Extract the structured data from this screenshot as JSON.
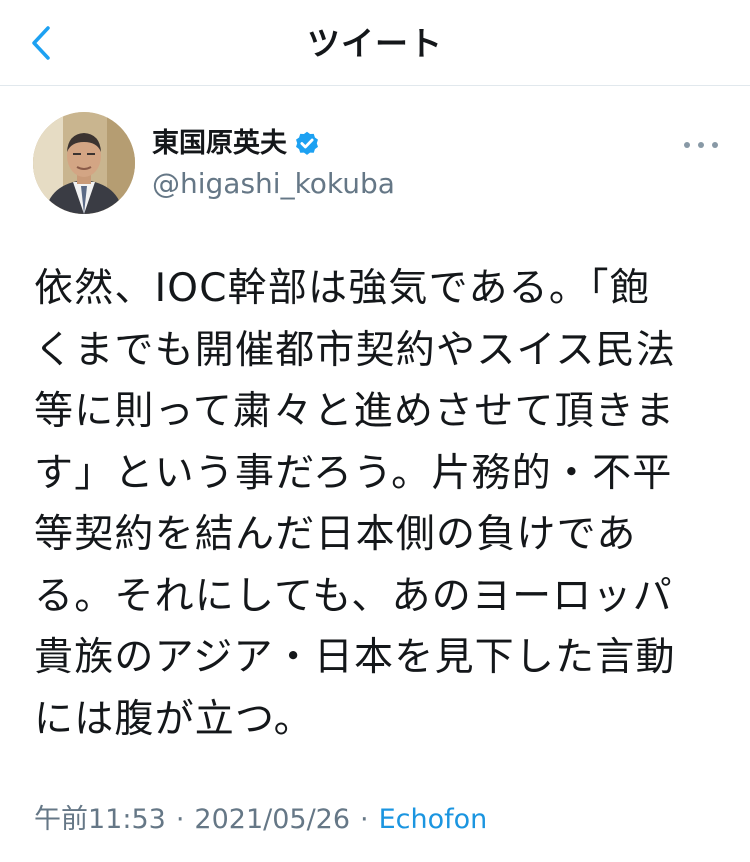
{
  "header": {
    "title": "ツイート"
  },
  "tweet": {
    "author_name": "東国原英夫",
    "author_handle": "@higashi_kokuba",
    "text": "依然、IOC幹部は強気である。「飽\nくまでも開催都市契約やスイス民法\n等に則って粛々と進めさせて頂きま\nす」という事だろう。片務的・不平\n等契約を結んだ日本側の負けであ\nる。それにしても、あのヨーロッパ\n貴族のアジア・日本を見下した言動\nには腹が立つ。",
    "time": "午前11:53",
    "separator": "·",
    "date": "2021/05/26",
    "source": "Echofon"
  },
  "icons": {
    "back": "chevron-left-icon",
    "verified": "verified-badge-icon",
    "more": "more-horizontal-icon"
  },
  "colors": {
    "accent": "#1da1f2",
    "secondary_text": "#657786",
    "link": "#1b95e0"
  }
}
